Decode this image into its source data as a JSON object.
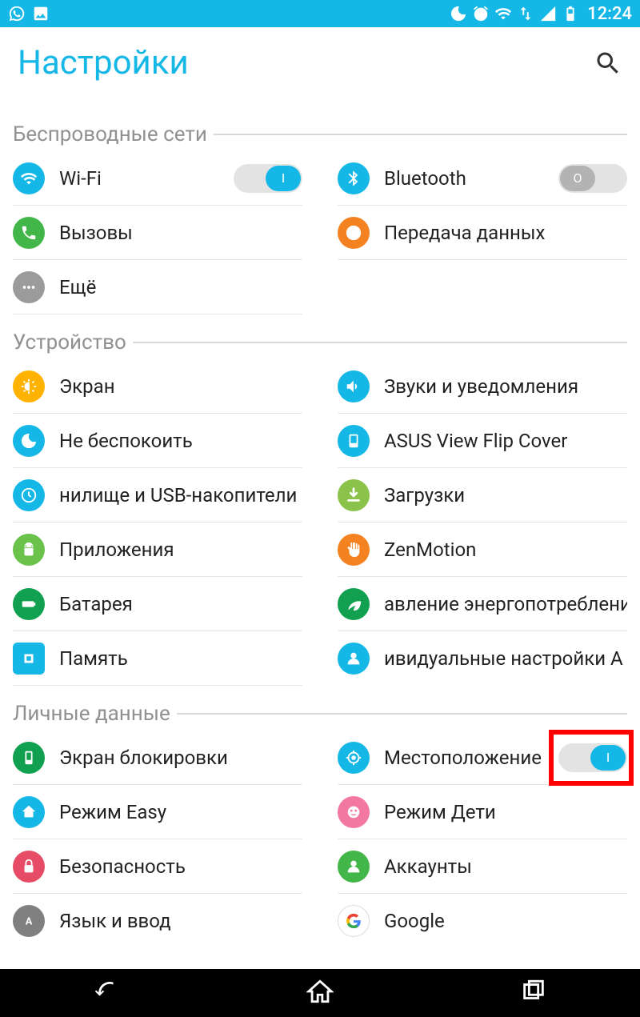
{
  "status": {
    "time": "12:24"
  },
  "header": {
    "title": "Настройки"
  },
  "sections": {
    "wireless": {
      "title": "Беспроводные сети",
      "wifi": "Wi-Fi",
      "bluetooth": "Bluetooth",
      "calls": "Вызовы",
      "data": "Передача данных",
      "more": "Ещё",
      "wifi_toggle": "I",
      "bt_toggle": "O"
    },
    "device": {
      "title": "Устройство",
      "display": "Экран",
      "sound": "Звуки и уведомления",
      "dnd": "Не беспокоить",
      "flipcover": "ASUS View Flip Cover",
      "storage": "нилище и USB-накопители",
      "downloads": "Загрузки",
      "apps": "Приложения",
      "zenmotion": "ZenMotion",
      "battery": "Батарея",
      "power": "авление энергопотреблени",
      "memory": "Память",
      "asus_custom": "ивидуальные настройки A"
    },
    "personal": {
      "title": "Личные данные",
      "lockscreen": "Экран блокировки",
      "location": "Местоположение",
      "location_toggle": "I",
      "easy": "Режим Easy",
      "kids": "Режим Дети",
      "security": "Безопасность",
      "accounts": "Аккаунты",
      "lang": "Язык и ввод",
      "google": "Google"
    }
  }
}
